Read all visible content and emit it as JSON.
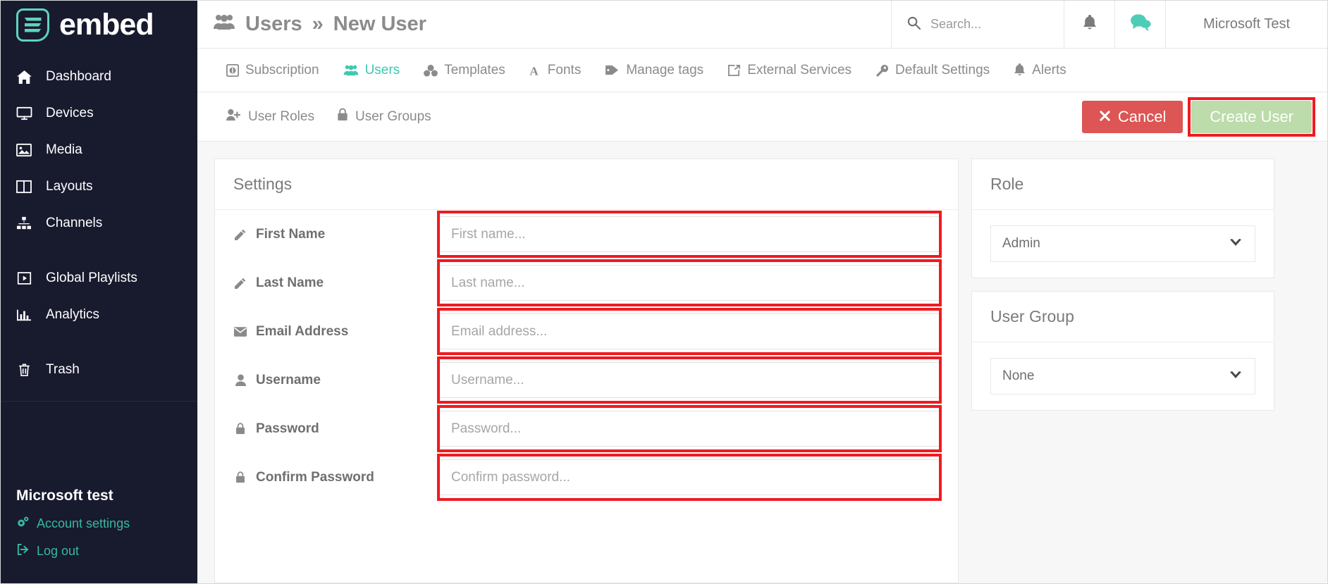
{
  "brand": {
    "name": "embed",
    "logo_color": "#5fd3bc"
  },
  "sidebar": {
    "items": [
      {
        "label": "Dashboard",
        "icon": "home-icon"
      },
      {
        "label": "Devices",
        "icon": "monitor-icon"
      },
      {
        "label": "Media",
        "icon": "image-icon"
      },
      {
        "label": "Layouts",
        "icon": "columns-icon"
      },
      {
        "label": "Channels",
        "icon": "sitemap-icon"
      },
      {
        "label": "Global Playlists",
        "icon": "play-square-icon"
      },
      {
        "label": "Analytics",
        "icon": "bar-chart-icon"
      },
      {
        "label": "Trash",
        "icon": "trash-icon"
      }
    ],
    "account": {
      "title": "Microsoft test",
      "settings_label": "Account settings",
      "logout_label": "Log out",
      "link_color": "#37b8a0"
    }
  },
  "header": {
    "title_primary": "Users",
    "separator": "»",
    "title_secondary": "New User",
    "title_icon": "users-icon",
    "search": {
      "placeholder": "Search...",
      "value": "",
      "icon": "search-icon"
    },
    "notifications_icon": "bell-icon",
    "chat_icon": "chat-bubbles-icon",
    "user_name": "Microsoft Test"
  },
  "tabs": [
    {
      "label": "Subscription",
      "icon": "dollar-circle-icon",
      "active": false
    },
    {
      "label": "Users",
      "icon": "users-icon",
      "active": true
    },
    {
      "label": "Templates",
      "icon": "templates-icon",
      "active": false
    },
    {
      "label": "Fonts",
      "icon": "font-icon",
      "active": false
    },
    {
      "label": "Manage tags",
      "icon": "tag-icon",
      "active": false
    },
    {
      "label": "External Services",
      "icon": "external-link-icon",
      "active": false
    },
    {
      "label": "Default Settings",
      "icon": "wrench-icon",
      "active": false
    },
    {
      "label": "Alerts",
      "icon": "bell-icon",
      "active": false
    }
  ],
  "subtabs": [
    {
      "label": "User Roles",
      "icon": "user-plus-icon"
    },
    {
      "label": "User Groups",
      "icon": "lock-icon"
    }
  ],
  "actions": {
    "cancel_label": "Cancel",
    "cancel_icon": "times-icon",
    "cancel_color": "#dd5554",
    "create_label": "Create User",
    "create_color": "#bcdcab",
    "highlight_color": "#ee1b21"
  },
  "settings_panel": {
    "title": "Settings",
    "fields": [
      {
        "label": "First Name",
        "icon": "pencil-icon",
        "placeholder": "First name...",
        "value": "",
        "type": "text",
        "highlighted": true
      },
      {
        "label": "Last Name",
        "icon": "pencil-icon",
        "placeholder": "Last name...",
        "value": "",
        "type": "text",
        "highlighted": true
      },
      {
        "label": "Email Address",
        "icon": "envelope-icon",
        "placeholder": "Email address...",
        "value": "",
        "type": "text",
        "highlighted": true
      },
      {
        "label": "Username",
        "icon": "user-icon",
        "placeholder": "Username...",
        "value": "",
        "type": "text",
        "highlighted": true
      },
      {
        "label": "Password",
        "icon": "lock-icon",
        "placeholder": "Password...",
        "value": "",
        "type": "password",
        "highlighted": true
      },
      {
        "label": "Confirm Password",
        "icon": "lock-icon",
        "placeholder": "Confirm password...",
        "value": "",
        "type": "password",
        "highlighted": true
      }
    ]
  },
  "role_panel": {
    "title": "Role",
    "selected": "Admin",
    "caret_icon": "chevron-down-icon"
  },
  "group_panel": {
    "title": "User Group",
    "selected": "None",
    "caret_icon": "chevron-down-icon"
  }
}
